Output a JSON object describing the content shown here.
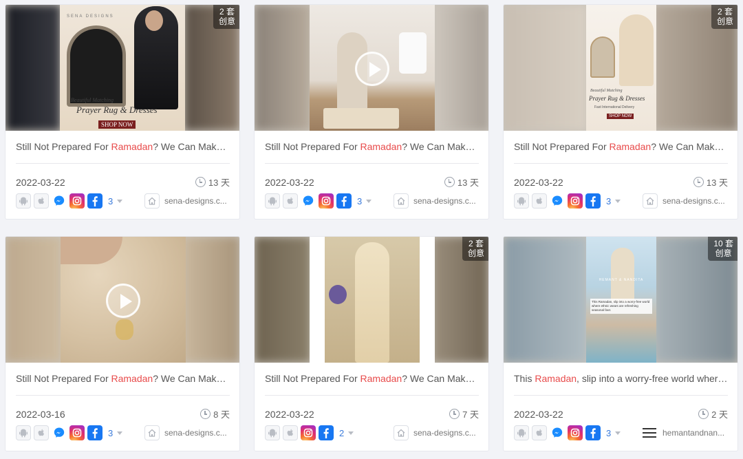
{
  "colors": {
    "highlight": "#e84b4b",
    "link": "#3b7bdb",
    "facebook": "#1877f2"
  },
  "cards": [
    {
      "title_pre": "Still Not Prepared For ",
      "title_hl": "Ramadan",
      "title_post": "? We Can Make…",
      "date": "2022-03-22",
      "days": "13 天",
      "badge_count": "2 套",
      "badge_label": "创意",
      "platforms": [
        "android-icon",
        "apple-icon",
        "messenger-icon",
        "instagram-icon",
        "facebook-icon"
      ],
      "platform_count": "3",
      "domain": "sena-designs.c...",
      "poster": {
        "brand": "SENA DESIGNS",
        "line1": "Beautiful Matching",
        "line2": "Prayer Rug & Dresses",
        "cta": "SHOP NOW"
      }
    },
    {
      "title_pre": "Still Not Prepared For ",
      "title_hl": "Ramadan",
      "title_post": "? We Can Make…",
      "date": "2022-03-22",
      "days": "13 天",
      "platforms": [
        "android-icon",
        "apple-icon",
        "messenger-icon",
        "instagram-icon",
        "facebook-icon"
      ],
      "platform_count": "3",
      "domain": "sena-designs.c..."
    },
    {
      "title_pre": "Still Not Prepared For ",
      "title_hl": "Ramadan",
      "title_post": "? We Can Make…",
      "date": "2022-03-22",
      "days": "13 天",
      "badge_count": "2 套",
      "badge_label": "创意",
      "platforms": [
        "android-icon",
        "apple-icon",
        "messenger-icon",
        "instagram-icon",
        "facebook-icon"
      ],
      "platform_count": "3",
      "domain": "sena-designs.c...",
      "poster": {
        "line1": "Beautiful Matching",
        "line2": "Prayer Rug & Dresses",
        "line3": "Fast International Delivery",
        "cta": "SHOP NOW"
      }
    },
    {
      "title_pre": "Still Not Prepared For ",
      "title_hl": "Ramadan",
      "title_post": "? We Can Make…",
      "date": "2022-03-16",
      "days": "8 天",
      "platforms": [
        "android-icon",
        "apple-icon",
        "messenger-icon",
        "instagram-icon",
        "facebook-icon"
      ],
      "platform_count": "3",
      "domain": "sena-designs.c..."
    },
    {
      "title_pre": "Still Not Prepared For ",
      "title_hl": "Ramadan",
      "title_post": "? We Can Make…",
      "date": "2022-03-22",
      "days": "7 天",
      "badge_count": "2 套",
      "badge_label": "创意",
      "platforms": [
        "android-icon",
        "apple-icon",
        "instagram-icon",
        "facebook-icon"
      ],
      "platform_count": "2",
      "domain": "sena-designs.c..."
    },
    {
      "title_pre": "This ",
      "title_hl": "Ramadan",
      "title_post": ", slip into a worry-free world wher…",
      "date": "2022-03-22",
      "days": "2 天",
      "badge_count": "10 套",
      "badge_label": "创意",
      "platforms": [
        "android-icon",
        "apple-icon",
        "messenger-icon",
        "instagram-icon",
        "facebook-icon"
      ],
      "platform_count": "3",
      "domain": "hemantandnan...",
      "poster": {
        "brand": "HEMANT & NANDITA",
        "text": "This Ramadan, slip into a worry-free world where ethnic wears are refreshing seasonal favs"
      }
    }
  ]
}
